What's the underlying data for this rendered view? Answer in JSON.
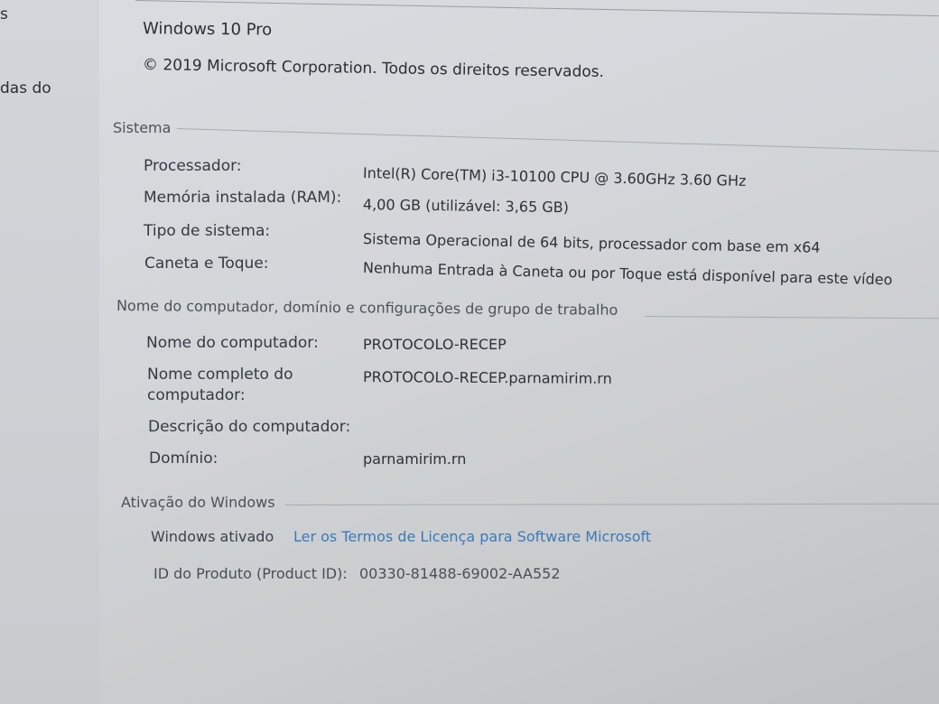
{
  "sidebar": {
    "fragment_top": "s",
    "fragment_link": "das do"
  },
  "windows_edition": {
    "edition": "Windows 10 Pro",
    "copyright": "© 2019 Microsoft Corporation. Todos os direitos reservados."
  },
  "system": {
    "title": "Sistema",
    "rows": [
      {
        "label": "Processador:",
        "value": "Intel(R) Core(TM) i3-10100 CPU @ 3.60GHz   3.60 GHz"
      },
      {
        "label": "Memória instalada (RAM):",
        "value": "4,00 GB (utilizável: 3,65 GB)"
      },
      {
        "label": "Tipo de sistema:",
        "value": "Sistema Operacional de 64 bits, processador com base em x64"
      },
      {
        "label": "Caneta e Toque:",
        "value": "Nenhuma Entrada à Caneta ou por Toque está disponível para este vídeo"
      }
    ]
  },
  "computer": {
    "title": "Nome do computador, domínio e configurações de grupo de trabalho",
    "rows": [
      {
        "label": "Nome do computador:",
        "value": "PROTOCOLO-RECEP"
      },
      {
        "label": "Nome completo do",
        "label2": "computador:",
        "value": "PROTOCOLO-RECEP.parnamirim.rn"
      },
      {
        "label": "Descrição do computador:",
        "value": ""
      },
      {
        "label": "Domínio:",
        "value": "parnamirim.rn"
      }
    ]
  },
  "activation": {
    "title": "Ativação do Windows",
    "status": "Windows ativado",
    "license_link": "Ler os Termos de Licença para Software Microsoft",
    "product_id_label": "ID do Produto (Product ID):",
    "product_id": "00330-81488-69002-AA552"
  }
}
